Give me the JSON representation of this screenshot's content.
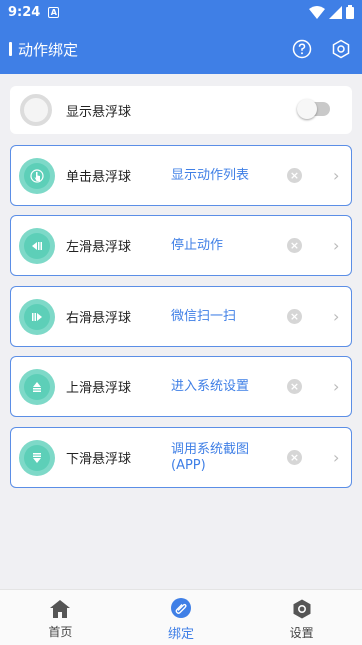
{
  "status": {
    "time": "9:24",
    "a_glyph": "A"
  },
  "appbar": {
    "title": "动作绑定"
  },
  "float_switch": {
    "label": "显示悬浮球",
    "enabled": false
  },
  "bindings": [
    {
      "gesture": "单击悬浮球",
      "action": "显示动作列表",
      "icon": "tap-icon"
    },
    {
      "gesture": "左滑悬浮球",
      "action": "停止动作",
      "icon": "swipe-left-icon"
    },
    {
      "gesture": "右滑悬浮球",
      "action": "微信扫一扫",
      "icon": "swipe-right-icon"
    },
    {
      "gesture": "上滑悬浮球",
      "action": "进入系统设置",
      "icon": "swipe-up-icon"
    },
    {
      "gesture": "下滑悬浮球",
      "action": "调用系统截图(APP)",
      "icon": "swipe-down-icon"
    }
  ],
  "nav": {
    "home": "首页",
    "bind": "绑定",
    "settings": "设置"
  },
  "colors": {
    "primary": "#3f7fe6",
    "accent": "#5dcfb8"
  }
}
